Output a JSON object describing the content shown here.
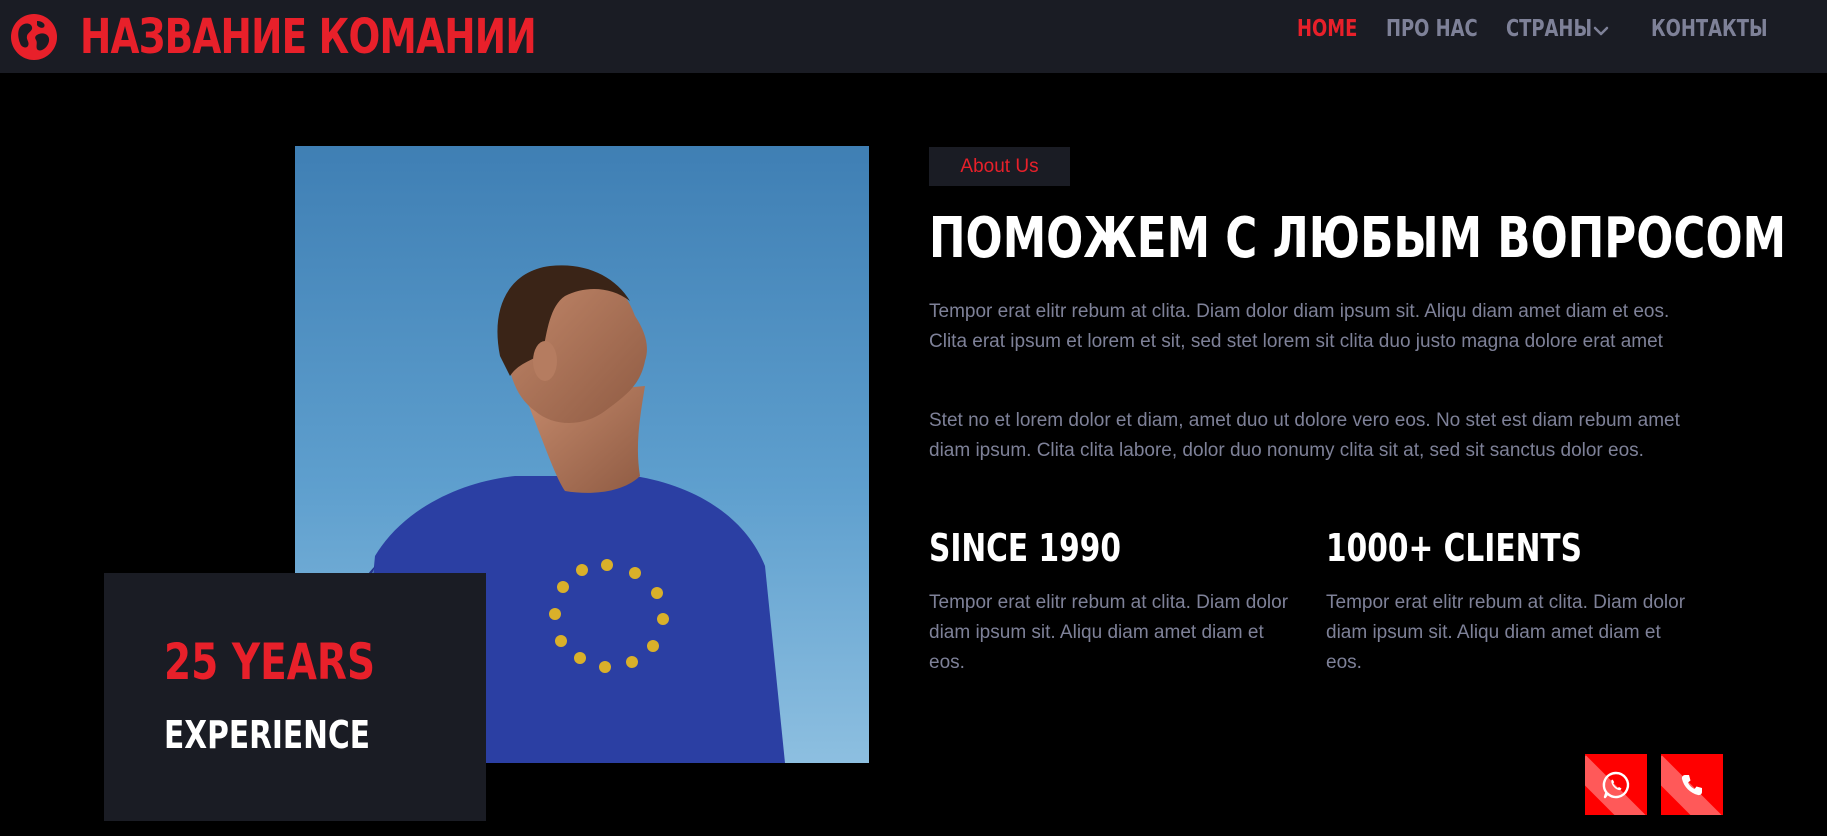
{
  "navbar": {
    "brand_name": "НАЗВАНИЕ КОМАНИИ",
    "logo_icon": "globe-icon",
    "links": [
      {
        "label": "HOME",
        "active": true
      },
      {
        "label": "ПРО НАС",
        "active": false
      },
      {
        "label": "СТРАНЫ",
        "active": false,
        "dropdown": true
      },
      {
        "label": "КОНТАКТЫ",
        "active": false
      }
    ]
  },
  "experience": {
    "years": "25 YEARS",
    "label": "EXPERIENCE"
  },
  "about": {
    "tag": "About Us",
    "headline": "ПОМОЖЕМ С ЛЮБЫМ ВОПРОСОМ",
    "paragraphs": [
      "Tempor erat elitr rebum at clita. Diam dolor diam ipsum sit. Aliqu diam amet diam et eos. Clita erat ipsum et lorem et sit, sed stet lorem sit clita duo justo magna dolore erat amet",
      "Stet no et lorem dolor et diam, amet duo ut dolore vero eos. No stet est diam rebum amet diam ipsum. Clita clita labore, dolor duo nonumy clita sit at, sed sit sanctus dolor eos."
    ],
    "stats": [
      {
        "title": "SINCE 1990",
        "text": "Tempor erat elitr rebum at clita. Diam dolor diam ipsum sit. Aliqu diam amet diam et eos."
      },
      {
        "title": "1000+ CLIENTS",
        "text": "Tempor erat elitr rebum at clita. Diam dolor diam ipsum sit. Aliqu diam amet diam et eos."
      }
    ]
  },
  "floating_buttons": [
    {
      "icon": "whatsapp-icon"
    },
    {
      "icon": "phone-icon"
    }
  ],
  "colors": {
    "accent": "#e8202a",
    "nav_bg": "#1a1c24",
    "page_bg": "#000000",
    "muted_text": "#7e8198",
    "button_red": "#ff0000"
  }
}
